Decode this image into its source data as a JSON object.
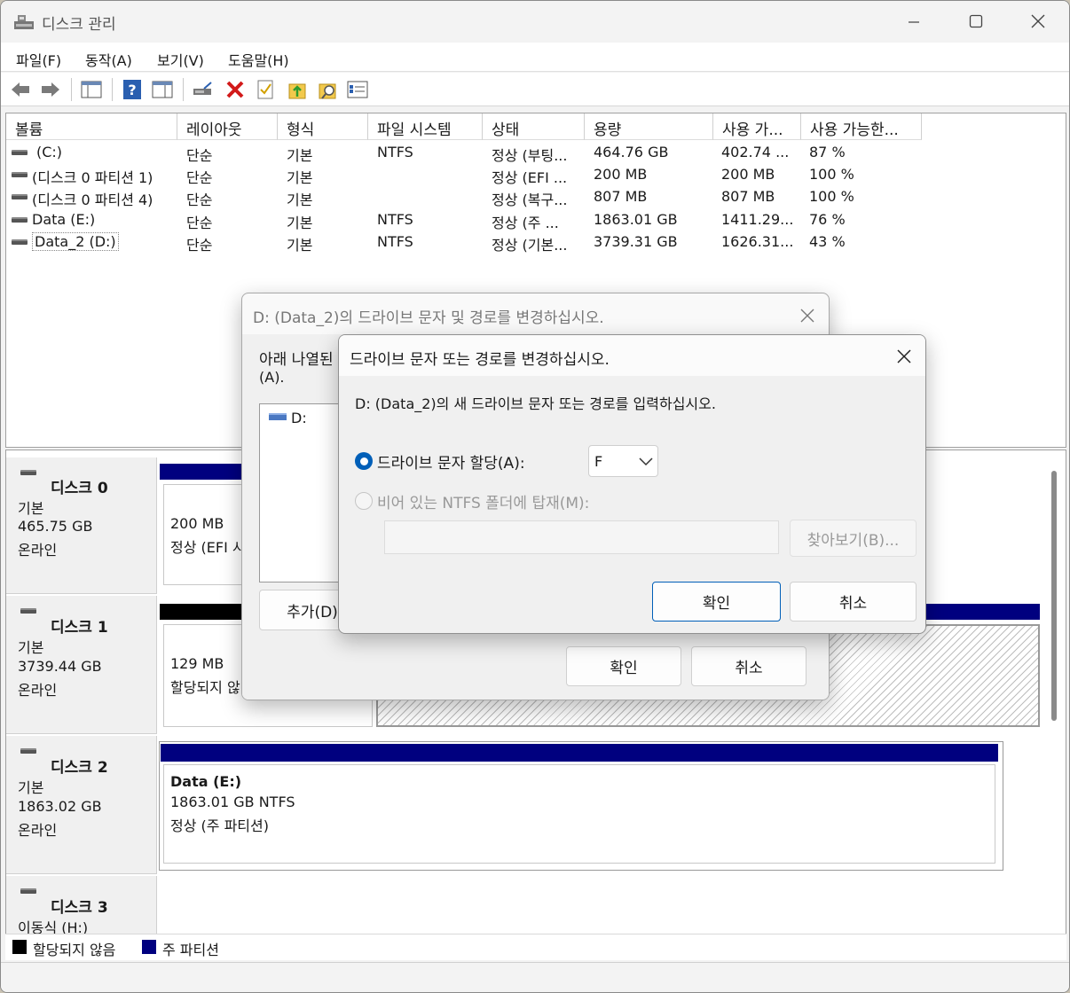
{
  "window": {
    "title": "디스크 관리"
  },
  "menu": [
    "파일(F)",
    "동작(A)",
    "보기(V)",
    "도움말(H)"
  ],
  "columns": [
    "볼륨",
    "레이아웃",
    "형식",
    "파일 시스템",
    "상태",
    "용량",
    "사용 가...",
    "사용 가능한..."
  ],
  "volumes": [
    {
      "name": "(C:)",
      "layout": "단순",
      "type": "기본",
      "fs": "NTFS",
      "status": "정상 (부팅...",
      "capacity": "464.76 GB",
      "free": "402.74 ...",
      "pct": "87 %"
    },
    {
      "name": "(디스크 0 파티션 1)",
      "layout": "단순",
      "type": "기본",
      "fs": "",
      "status": "정상 (EFI ...",
      "capacity": "200 MB",
      "free": "200 MB",
      "pct": "100 %"
    },
    {
      "name": "(디스크 0 파티션 4)",
      "layout": "단순",
      "type": "기본",
      "fs": "",
      "status": "정상 (복구...",
      "capacity": "807 MB",
      "free": "807 MB",
      "pct": "100 %"
    },
    {
      "name": "Data (E:)",
      "layout": "단순",
      "type": "기본",
      "fs": "NTFS",
      "status": "정상 (주 ...",
      "capacity": "1863.01 GB",
      "free": "1411.29...",
      "pct": "76 %"
    },
    {
      "name": "Data_2 (D:)",
      "layout": "단순",
      "type": "기본",
      "fs": "NTFS",
      "status": "정상 (기본...",
      "capacity": "3739.31 GB",
      "free": "1626.31...",
      "pct": "43 %"
    }
  ],
  "disks": [
    {
      "name": "디스크 0",
      "kind": "기본",
      "size": "465.75 GB",
      "state": "온라인",
      "part_size": "200 MB",
      "part_status": "정상 (EFI 시"
    },
    {
      "name": "디스크 1",
      "kind": "기본",
      "size": "3739.44 GB",
      "state": "온라인",
      "part_size": "129 MB",
      "part_status": "할당되지 않"
    },
    {
      "name": "디스크 2",
      "kind": "기본",
      "size": "1863.02 GB",
      "state": "온라인",
      "part_name": "Data  (E:)",
      "part_size": "1863.01 GB NTFS",
      "part_status": "정상 (주 파티션)"
    },
    {
      "name": "디스크 3",
      "kind": "이동식 (H:)"
    }
  ],
  "legend": {
    "unallocated": "할당되지 않음",
    "primary": "주 파티션"
  },
  "dialog_outer": {
    "title": "D: (Data_2)의 드라이브 문자 및 경로를 변경하십시오.",
    "instruction": "아래 나열된",
    "instruction_2": "(A).",
    "list_item": "D:",
    "add_button": "추가(D)",
    "ok": "확인",
    "cancel": "취소"
  },
  "dialog_inner": {
    "title": "드라이브 문자 또는 경로를 변경하십시오.",
    "instruction": "D: (Data_2)의 새 드라이브 문자 또는 경로를 입력하십시오.",
    "radio_assign": "드라이브 문자 할당(A):",
    "radio_assign_selected": true,
    "drive_letter": "F",
    "radio_mount": "비어 있는 NTFS 폴더에 탑재(M):",
    "radio_mount_selected": false,
    "folder_path": "",
    "browse": "찾아보기(B)...",
    "ok": "확인",
    "cancel": "취소"
  },
  "colors": {
    "primary_partition": "#00007f",
    "unallocated": "#000000",
    "accent": "#005fb8"
  }
}
